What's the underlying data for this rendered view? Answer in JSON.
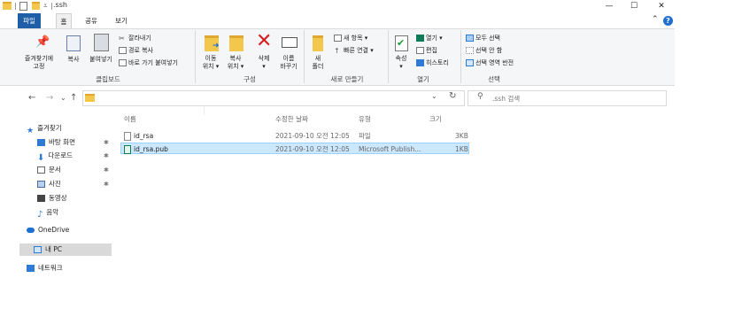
{
  "title": {
    "path": ".ssh",
    "window_controls": [
      "—",
      "☐",
      "✕"
    ]
  },
  "tabs": [
    {
      "label": "파일",
      "active": false
    },
    {
      "label": "홈",
      "active": true
    },
    {
      "label": "공유",
      "active": false
    },
    {
      "label": "보기",
      "active": false
    }
  ],
  "ribbon": {
    "clipboard": {
      "label": "클립보드",
      "pin": "즐겨찾기에\n고정",
      "copy": "복사",
      "paste": "붙여넣기",
      "cut": "잘라내기",
      "copy_path": "경로 복사",
      "paste_shortcut": "바로 가기 붙여넣기"
    },
    "organize": {
      "label": "구성",
      "move_to": "이동\n위치 ▾",
      "copy_to": "복사\n위치 ▾",
      "delete": "삭제\n▾",
      "rename": "이름\n바꾸기"
    },
    "new": {
      "label": "새로 만들기",
      "new_folder": "새\n폴더",
      "new_item": "새 항목 ▾",
      "easy_access": "빠른 연결 ▾"
    },
    "open": {
      "label": "열기",
      "properties": "속성\n▾",
      "open": "열기 ▾",
      "edit": "편집",
      "history": "히스토리"
    },
    "select": {
      "label": "선택",
      "select_all": "모두 선택",
      "select_none": "선택 안 함",
      "invert": "선택 영역 반전"
    }
  },
  "address": {
    "search_placeholder": ".ssh 검색"
  },
  "nav": {
    "quick_access": "즐겨찾기",
    "items": [
      {
        "label": "바탕 화면",
        "pinned": true
      },
      {
        "label": "다운로드",
        "pinned": true
      },
      {
        "label": "문서",
        "pinned": true
      },
      {
        "label": "사진",
        "pinned": true
      },
      {
        "label": "동영상",
        "pinned": false
      },
      {
        "label": "음악",
        "pinned": false
      }
    ],
    "onedrive": "OneDrive",
    "this_pc": "내 PC",
    "network": "네트워크"
  },
  "columns": {
    "name": "이름",
    "modified": "수정한 날짜",
    "type": "유형",
    "size": "크기"
  },
  "files": [
    {
      "name": "id_rsa",
      "modified": "2021-09-10 오전 12:05",
      "type": "파일",
      "size": "3KB",
      "selected": false
    },
    {
      "name": "id_rsa.pub",
      "modified": "2021-09-10 오전 12:05",
      "type": "Microsoft Publish...",
      "size": "1KB",
      "selected": true
    }
  ],
  "colors": {
    "file_tab": "#1f5fa8",
    "selection": "#cce8ff",
    "selection_border": "#99d1ff",
    "folder": "#f3c74b",
    "delete_red": "#d42020",
    "help": "#1f6fd0"
  }
}
